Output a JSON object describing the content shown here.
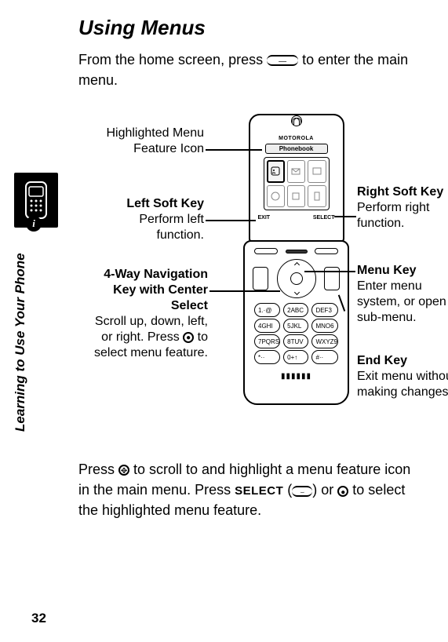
{
  "title": "Using Menus",
  "intro": {
    "before": "From the home screen, press ",
    "after": " to enter the main menu."
  },
  "side_label": "Learning to Use Your Phone",
  "phone": {
    "brand": "MOTOROLA",
    "screen_title": "Phonebook",
    "softkey_left": "EXIT",
    "softkey_right": "SELECT",
    "keys": [
      "1.·@",
      "2ABC",
      "DEF3",
      "4GHI",
      "5JKL",
      "MNO6",
      "7PQRS",
      "8TUV",
      "WXYZ9",
      "*··",
      "0+↑",
      "#··"
    ]
  },
  "callouts": {
    "highlighted": "Highlighted Menu Feature Icon",
    "left_soft": {
      "title": "Left Soft Key",
      "desc": "Perform left function."
    },
    "nav": {
      "title": "4-Way Navigation Key with Center Select",
      "desc_before": "Scroll up, down, left, or right. Press ",
      "desc_after": " to select menu feature."
    },
    "right_soft": {
      "title": "Right Soft Key",
      "desc": "Perform right function."
    },
    "menu_key": {
      "title": "Menu Key",
      "desc": "Enter menu system, or open a sub-menu."
    },
    "end_key": {
      "title": "End Key",
      "desc": "Exit menu without making changes."
    }
  },
  "bottom": {
    "p1": "Press ",
    "p2": " to scroll to and highlight a menu feature icon in the main menu. Press ",
    "select_label": "SELECT",
    "p3": " (",
    "p4": ") or ",
    "p5": " to select the highlighted menu feature."
  },
  "page_number": "32"
}
